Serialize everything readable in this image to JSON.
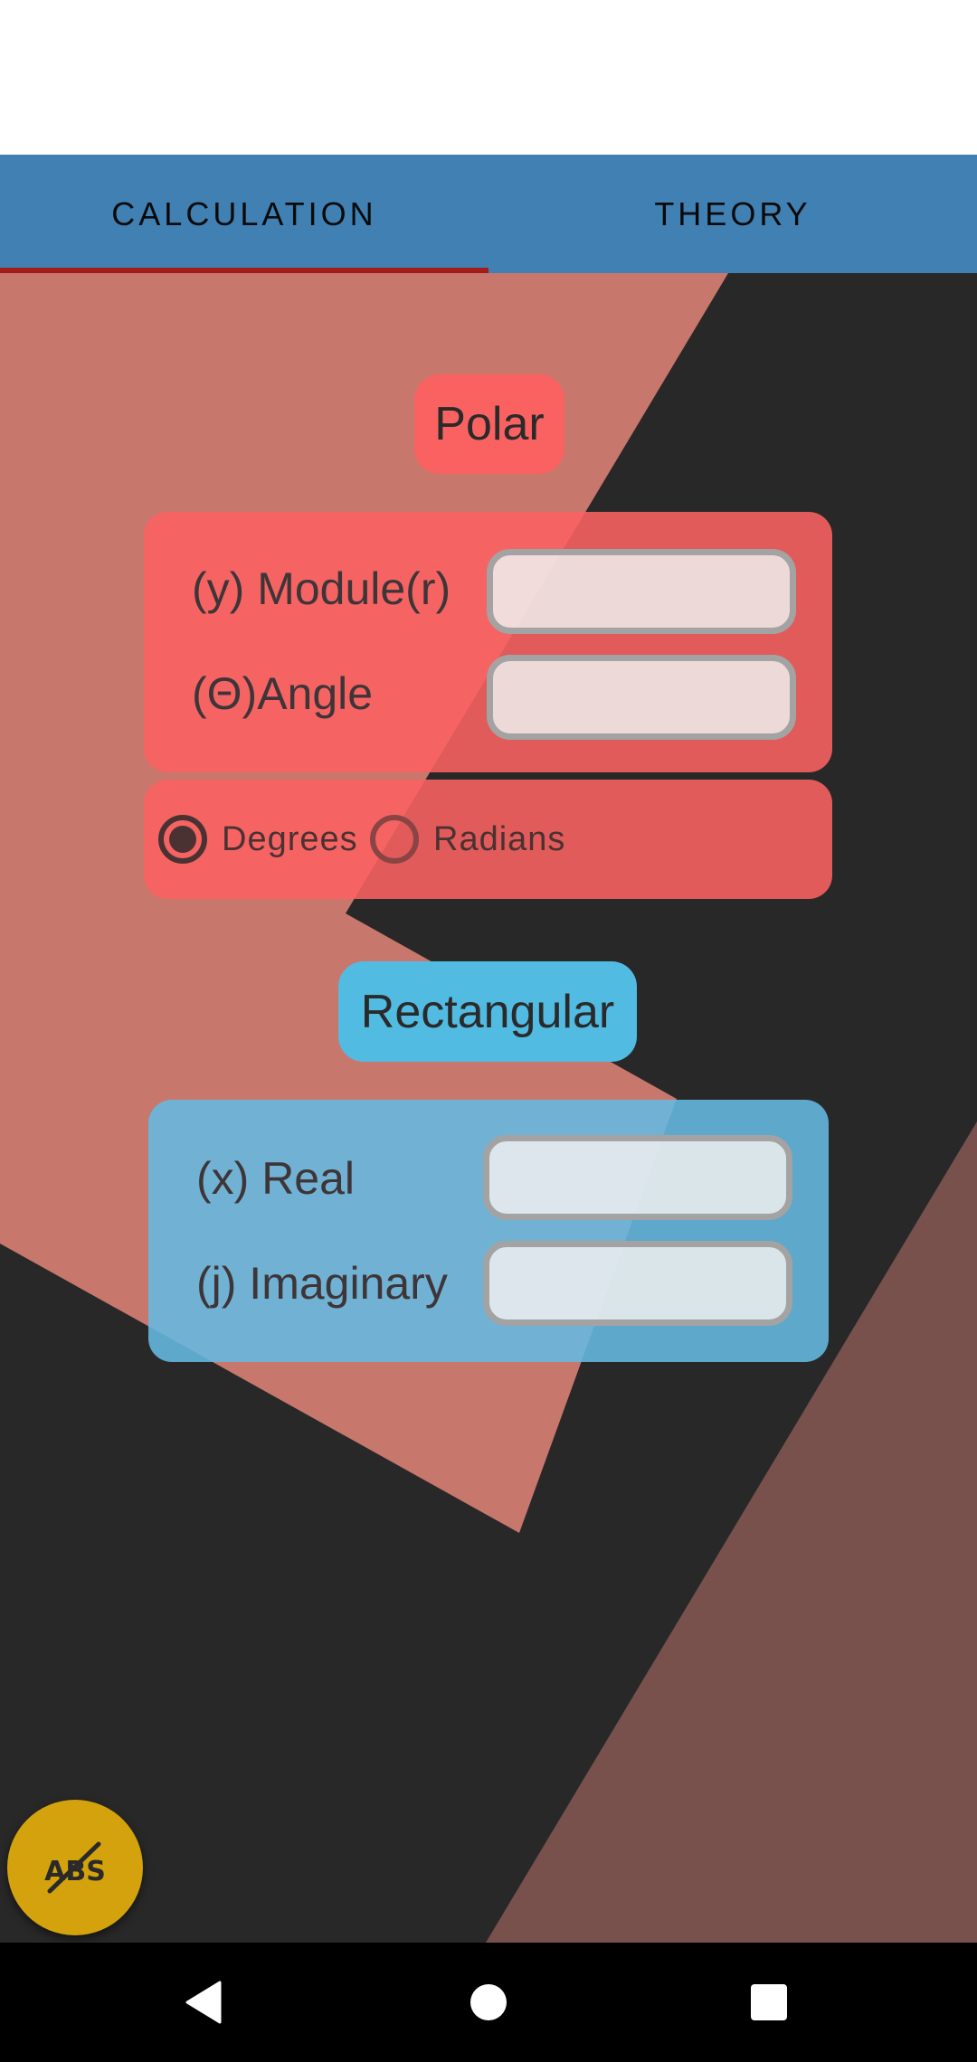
{
  "tabs": [
    {
      "label": "CALCULATION",
      "selected": true
    },
    {
      "label": "THEORY",
      "selected": false
    }
  ],
  "polar": {
    "title": "Polar",
    "module_label": "(y) Module(r)",
    "module_value": "",
    "angle_label": "(Θ)Angle",
    "angle_value": "",
    "angle_unit_options": [
      {
        "label": "Degrees",
        "selected": true
      },
      {
        "label": "Radians",
        "selected": false
      }
    ]
  },
  "rectangular": {
    "title": "Rectangular",
    "real_label": "(x) Real",
    "real_value": "",
    "imaginary_label": "(j) Imaginary",
    "imaginary_value": ""
  },
  "fab": {
    "icon": "abs-off-icon",
    "text": "ABS"
  },
  "navigation": {
    "back": "back-icon",
    "home": "home-icon",
    "recents": "recents-icon"
  },
  "colors": {
    "tabbar": "#4080b3",
    "tab_indicator": "#a31c1c",
    "polar_accent": "#fa6262",
    "rectangular_accent": "#52bbe2",
    "fab": "#d4a20c",
    "background": "#282828",
    "bg_salmon": "#c8776d",
    "bg_brown": "#78504c"
  }
}
